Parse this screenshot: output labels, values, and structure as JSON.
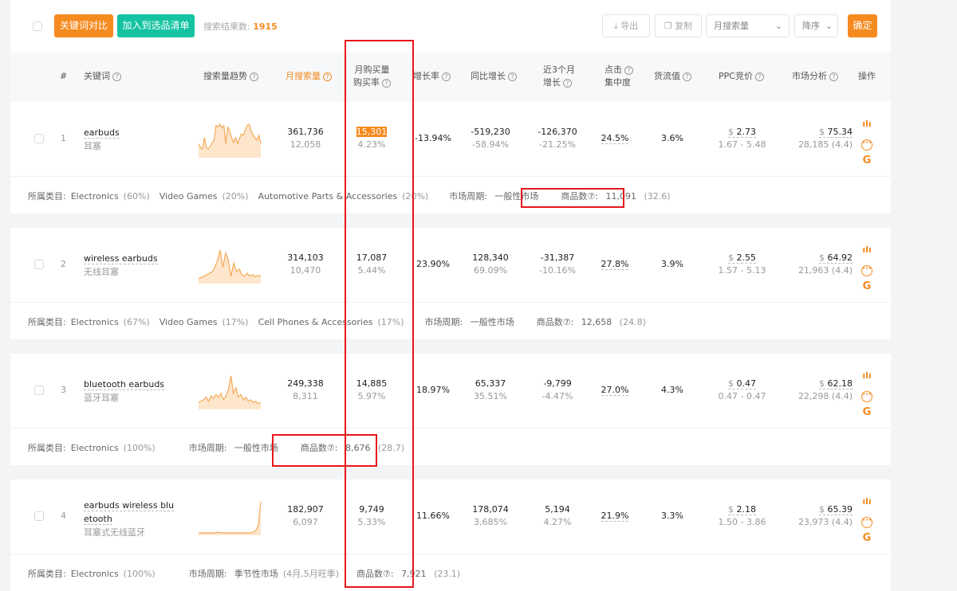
{
  "toolbar": {
    "compare": "关键词对比",
    "add_list": "加入到选品清单",
    "result_label": "搜索结果数: ",
    "result_count": "1915",
    "export": "导出",
    "copy": "复制",
    "sort_field": "月搜索量",
    "sort_order": "降序",
    "confirm": "确定"
  },
  "colors": {
    "orange": "#f58a1f",
    "green": "#14c3a2",
    "highlight": "#f58a1f",
    "annotation": "#e8161c"
  },
  "headers": {
    "num": "#",
    "keyword": "关键词",
    "trend": "搜索量趋势",
    "monthly_search": "月搜索量",
    "purchase_1": "月购买量",
    "purchase_2": "购买率",
    "growth": "增长率",
    "yoy": "同比增长",
    "recent_1": "近3个月",
    "recent_2": "增长",
    "click_1": "点击",
    "click_2": "集中度",
    "flow": "货流值",
    "ppc": "PPC竞价",
    "market": "市场分析",
    "ops": "操作"
  },
  "footer_labels": {
    "category": "所属类目:",
    "cycle": "市场周期: ",
    "products": "商品数⑦: "
  },
  "rows": [
    {
      "num": "1",
      "kw": "earbuds",
      "kw_cn": "耳塞",
      "search": "361,736",
      "search_sub": "12,058",
      "purchase": "15,301",
      "rate": "4.23%",
      "growth": "-13.94%",
      "yoy": "-519,230",
      "yoy_pct": "-58.94%",
      "m3": "-126,370",
      "m3_pct": "-21.25%",
      "click": "24.5%",
      "flow": "3.6%",
      "ppc": "2.73",
      "ppc_range": "1.67 - 5.48",
      "price": "75.34",
      "market_sub": "28,185 (4.4)",
      "cats": [
        {
          "n": "Electronics",
          "p": "(60%)"
        },
        {
          "n": "Video Games",
          "p": "(20%)"
        },
        {
          "n": "Automotive Parts & Accessories",
          "p": "(20%)"
        }
      ],
      "cycle": "一般性市场",
      "cycle_note": "",
      "products": "11,091",
      "products_sub": "(32.6)",
      "trend": [
        20,
        14,
        12,
        30,
        14,
        12,
        16,
        22,
        26,
        50,
        48,
        52,
        46,
        50,
        20,
        48,
        40,
        30,
        22,
        30,
        20,
        28,
        36,
        34,
        42,
        50,
        52,
        42,
        34,
        30,
        26,
        34,
        20
      ]
    },
    {
      "num": "2",
      "kw": "wireless earbuds",
      "kw_cn": "无线耳塞",
      "search": "314,103",
      "search_sub": "10,470",
      "purchase": "17,087",
      "rate": "5.44%",
      "growth": "23.90%",
      "yoy": "128,340",
      "yoy_pct": "69.09%",
      "m3": "-31,387",
      "m3_pct": "-10.16%",
      "click": "27.8%",
      "flow": "3.9%",
      "ppc": "2.55",
      "ppc_range": "1.57 - 5.13",
      "price": "64.92",
      "market_sub": "21,963 (4.4)",
      "cats": [
        {
          "n": "Electronics",
          "p": "(67%)"
        },
        {
          "n": "Video Games",
          "p": "(17%)"
        },
        {
          "n": "Cell Phones & Accessories",
          "p": "(17%)"
        }
      ],
      "cycle": "一般性市场",
      "cycle_note": "",
      "products": "12,658",
      "products_sub": "(24.8)",
      "trend": [
        5,
        6,
        8,
        10,
        12,
        14,
        20,
        30,
        44,
        20,
        40,
        30,
        8,
        26,
        14,
        18,
        10,
        8,
        12,
        8,
        10,
        7,
        9,
        8
      ]
    },
    {
      "num": "3",
      "kw": "bluetooth earbuds",
      "kw_cn": "蓝牙耳塞",
      "search": "249,338",
      "search_sub": "8,311",
      "purchase": "14,885",
      "rate": "5.97%",
      "growth": "18.97%",
      "yoy": "65,337",
      "yoy_pct": "35.51%",
      "m3": "-9,799",
      "m3_pct": "-4.47%",
      "click": "27.0%",
      "flow": "4.3%",
      "ppc": "0.47",
      "ppc_range": "0.47 - 0.47",
      "price": "62.18",
      "market_sub": "22,298 (4.4)",
      "cats": [
        {
          "n": "Electronics",
          "p": "(100%)"
        }
      ],
      "cycle": "一般性市场",
      "cycle_note": "",
      "products": "8,676",
      "products_sub": "(28.7)",
      "trend": [
        8,
        10,
        12,
        16,
        10,
        18,
        14,
        20,
        16,
        22,
        12,
        18,
        28,
        48,
        22,
        30,
        16,
        20,
        12,
        16,
        10,
        12,
        8,
        10,
        6,
        8
      ]
    },
    {
      "num": "4",
      "kw": "earbuds wireless blu",
      "kw2": "etooth",
      "kw_cn": "耳塞式无线蓝牙",
      "search": "182,907",
      "search_sub": "6,097",
      "purchase": "9,749",
      "rate": "5.33%",
      "growth": "11.66%",
      "yoy": "178,074",
      "yoy_pct": "3,685%",
      "m3": "5,194",
      "m3_pct": "4.27%",
      "click": "21.9%",
      "flow": "3.3%",
      "ppc": "2.18",
      "ppc_range": "1.50 - 3.86",
      "price": "65.39",
      "market_sub": "23,973 (4.4)",
      "cats": [
        {
          "n": "Electronics",
          "p": "(100%)"
        }
      ],
      "cycle": "季节性市场",
      "cycle_note": "(4月,5月旺季)",
      "products": "7,921",
      "products_sub": "(23.1)",
      "trend": [
        1,
        1,
        1,
        1,
        1,
        1,
        1,
        1,
        2,
        1,
        1,
        1,
        1,
        1,
        1,
        1,
        1,
        1,
        1,
        1,
        1,
        1,
        2,
        4,
        10,
        40
      ]
    }
  ]
}
